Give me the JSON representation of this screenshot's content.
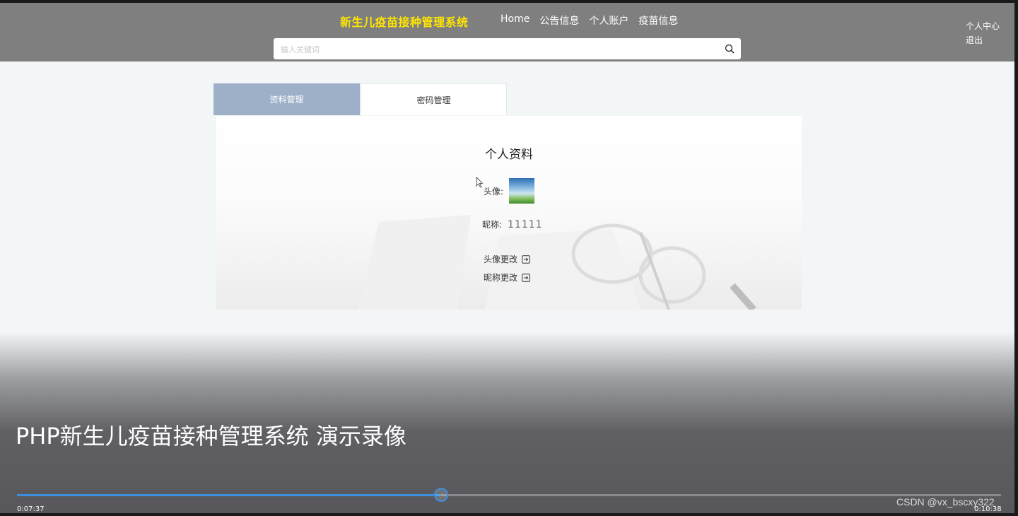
{
  "header": {
    "site_title": "新生儿疫苗接种管理系统",
    "nav": [
      {
        "label": "Home"
      },
      {
        "label": "公告信息"
      },
      {
        "label": "个人账户"
      },
      {
        "label": "疫苗信息"
      }
    ],
    "user_links": [
      {
        "label": "个人中心"
      },
      {
        "label": "退出"
      }
    ],
    "search": {
      "placeholder": "输入关键词",
      "value": ""
    },
    "title_color": "#ffe600"
  },
  "tabs": [
    {
      "label": "资料管理",
      "active": true
    },
    {
      "label": "密码管理",
      "active": false
    }
  ],
  "profile": {
    "title": "个人资料",
    "avatar_label": "头像:",
    "nickname_label": "昵称:",
    "nickname_value": "11111",
    "actions": [
      {
        "label": "头像更改",
        "icon": "arrow-right-box-icon"
      },
      {
        "label": "昵称更改",
        "icon": "arrow-right-box-icon"
      }
    ]
  },
  "video": {
    "title": "PHP新生儿疫苗接种管理系统 演示录像",
    "current_time": "0:07:37",
    "total_time": "0:10:38",
    "progress_fraction": 0.4307,
    "accent_color": "#3c8fe0",
    "watermark": "CSDN @vx_bscxy322"
  }
}
